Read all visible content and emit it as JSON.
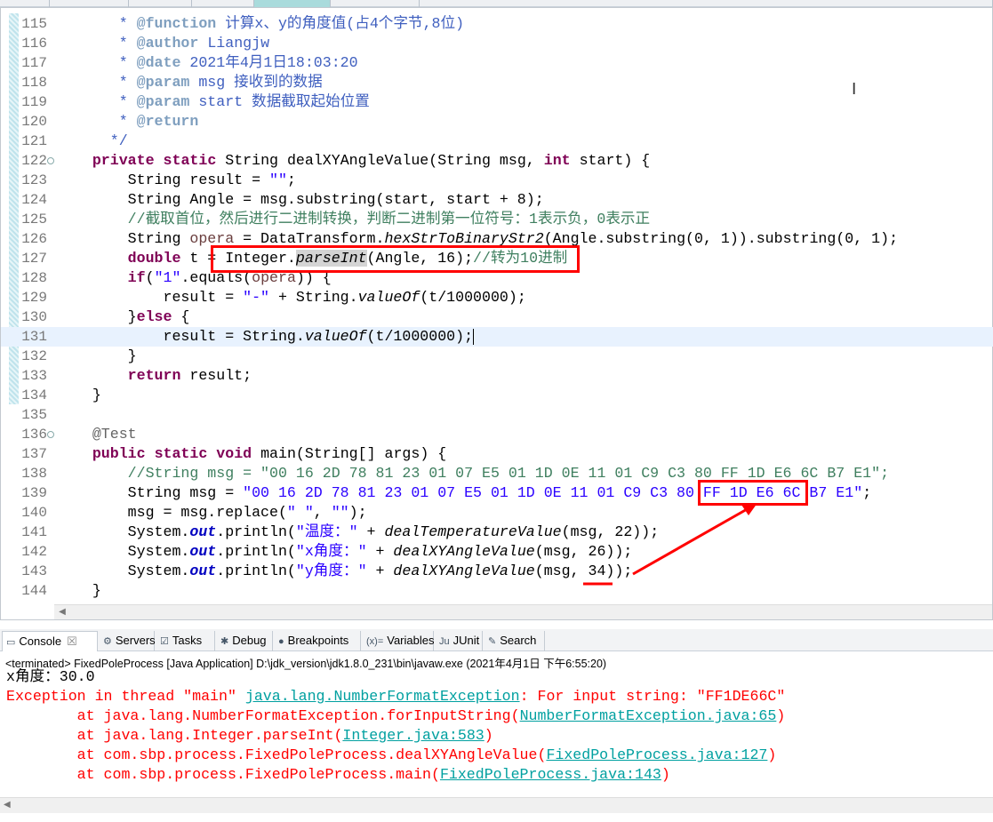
{
  "editor": {
    "lines": [
      {
        "n": "115",
        "t": [
          [
            "",
            "       "
          ],
          [
            "jd",
            "* "
          ],
          [
            "jt",
            "@function"
          ],
          [
            "jd",
            " 计算x、y的角度值(占4个字节,8位)"
          ]
        ]
      },
      {
        "n": "116",
        "t": [
          [
            "",
            "       "
          ],
          [
            "jd",
            "* "
          ],
          [
            "jt",
            "@author"
          ],
          [
            "jd",
            " Liangjw"
          ]
        ]
      },
      {
        "n": "117",
        "t": [
          [
            "",
            "       "
          ],
          [
            "jd",
            "* "
          ],
          [
            "jt",
            "@date"
          ],
          [
            "jd",
            " 2021年4月1日18:03:20"
          ]
        ]
      },
      {
        "n": "118",
        "t": [
          [
            "",
            "       "
          ],
          [
            "jd",
            "* "
          ],
          [
            "jt",
            "@param"
          ],
          [
            "jd",
            " msg 接收到的数据"
          ]
        ]
      },
      {
        "n": "119",
        "t": [
          [
            "",
            "       "
          ],
          [
            "jd",
            "* "
          ],
          [
            "jt",
            "@param"
          ],
          [
            "jd",
            " start 数据截取起始位置"
          ]
        ]
      },
      {
        "n": "120",
        "t": [
          [
            "",
            "       "
          ],
          [
            "jd",
            "* "
          ],
          [
            "jt",
            "@return"
          ]
        ]
      },
      {
        "n": "121",
        "t": [
          [
            "",
            "      "
          ],
          [
            "jd",
            "*/"
          ]
        ]
      },
      {
        "n": "122",
        "fold": true,
        "t": [
          [
            "",
            "    "
          ],
          [
            "kw",
            "private"
          ],
          [
            "",
            " "
          ],
          [
            "kw",
            "static"
          ],
          [
            "",
            " String dealXYAngleValue(String msg, "
          ],
          [
            "kw",
            "int"
          ],
          [
            "",
            " start) {"
          ]
        ]
      },
      {
        "n": "123",
        "t": [
          [
            "",
            "        String result = "
          ],
          [
            "st",
            "\"\""
          ],
          [
            "",
            ";"
          ]
        ]
      },
      {
        "n": "124",
        "t": [
          [
            "",
            "        String Angle = msg.substring(start, start + 8);"
          ]
        ]
      },
      {
        "n": "125",
        "t": [
          [
            "",
            "        "
          ],
          [
            "cm",
            "//截取首位，然后进行二进制转换，判断二进制第一位符号：1表示负，0表示正"
          ]
        ]
      },
      {
        "n": "126",
        "t": [
          [
            "",
            "        String "
          ],
          [
            "lv",
            "opera"
          ],
          [
            "",
            " = DataTransform."
          ],
          [
            "it",
            "hexStrToBinaryStr2"
          ],
          [
            "",
            "(Angle.substring(0, 1)).substring(0, 1);"
          ]
        ]
      },
      {
        "n": "127",
        "t": [
          [
            "",
            "        "
          ],
          [
            "kw",
            "double"
          ],
          [
            "",
            " t = Integer."
          ],
          [
            "it hl",
            "parseInt"
          ],
          [
            "",
            "(Angle, 16);"
          ],
          [
            "cm",
            "//转为10进制"
          ]
        ]
      },
      {
        "n": "128",
        "t": [
          [
            "",
            "        "
          ],
          [
            "kw",
            "if"
          ],
          [
            "",
            "("
          ],
          [
            "st",
            "\"1\""
          ],
          [
            "",
            ".equals("
          ],
          [
            "lv",
            "opera"
          ],
          [
            "",
            ")) {"
          ]
        ]
      },
      {
        "n": "129",
        "t": [
          [
            "",
            "            result = "
          ],
          [
            "st",
            "\"-\""
          ],
          [
            "",
            " + String."
          ],
          [
            "it",
            "valueOf"
          ],
          [
            "",
            "(t/1000000);"
          ]
        ]
      },
      {
        "n": "130",
        "t": [
          [
            "",
            "        }"
          ],
          [
            "kw",
            "else"
          ],
          [
            "",
            " {"
          ]
        ]
      },
      {
        "n": "131",
        "cur": true,
        "t": [
          [
            "",
            "            result = String."
          ],
          [
            "it",
            "valueOf"
          ],
          [
            "",
            "(t/1000000);"
          ]
        ]
      },
      {
        "n": "132",
        "t": [
          [
            "",
            "        }"
          ]
        ]
      },
      {
        "n": "133",
        "t": [
          [
            "",
            "        "
          ],
          [
            "kw",
            "return"
          ],
          [
            "",
            " result;"
          ]
        ]
      },
      {
        "n": "134",
        "t": [
          [
            "",
            "    }"
          ]
        ]
      },
      {
        "n": "135",
        "t": []
      },
      {
        "n": "136",
        "fold": true,
        "t": [
          [
            "",
            "    "
          ],
          [
            "an",
            "@Test"
          ]
        ]
      },
      {
        "n": "137",
        "t": [
          [
            "",
            "    "
          ],
          [
            "kw",
            "public"
          ],
          [
            "",
            " "
          ],
          [
            "kw",
            "static"
          ],
          [
            "",
            " "
          ],
          [
            "kw",
            "void"
          ],
          [
            "",
            " main(String[] args) {"
          ]
        ]
      },
      {
        "n": "138",
        "t": [
          [
            "",
            "        "
          ],
          [
            "cm",
            "//String msg = \"00 16 2D 78 81 23 01 07 E5 01 1D 0E 11 01 C9 C3 80 FF 1D E6 6C B7 E1\";"
          ]
        ]
      },
      {
        "n": "139",
        "t": [
          [
            "",
            "        String msg = "
          ],
          [
            "st",
            "\"00 16 2D 78 81 23 01 07 E5 01 1D 0E 11 01 C9 C3 80 FF 1D E6 6C B7 E1\""
          ],
          [
            "",
            ";"
          ]
        ]
      },
      {
        "n": "140",
        "t": [
          [
            "",
            "        msg = msg.replace("
          ],
          [
            "st",
            "\" \""
          ],
          [
            "",
            ", "
          ],
          [
            "st",
            "\"\""
          ],
          [
            "",
            ");"
          ]
        ]
      },
      {
        "n": "141",
        "t": [
          [
            "",
            "        System."
          ],
          [
            "fld",
            "out"
          ],
          [
            "",
            ".println("
          ],
          [
            "st",
            "\"温度：\""
          ],
          [
            "",
            " + "
          ],
          [
            "it",
            "dealTemperatureValue"
          ],
          [
            "",
            "(msg, 22));"
          ]
        ]
      },
      {
        "n": "142",
        "t": [
          [
            "",
            "        System."
          ],
          [
            "fld",
            "out"
          ],
          [
            "",
            ".println("
          ],
          [
            "st",
            "\"x角度：\""
          ],
          [
            "",
            " + "
          ],
          [
            "it",
            "dealXYAngleValue"
          ],
          [
            "",
            "(msg, 26));"
          ]
        ]
      },
      {
        "n": "143",
        "t": [
          [
            "",
            "        System."
          ],
          [
            "fld",
            "out"
          ],
          [
            "",
            ".println("
          ],
          [
            "st",
            "\"y角度：\""
          ],
          [
            "",
            " + "
          ],
          [
            "it",
            "dealXYAngleValue"
          ],
          [
            "",
            "(msg, 34));"
          ]
        ]
      },
      {
        "n": "144",
        "t": [
          [
            "",
            "    }"
          ]
        ]
      }
    ]
  },
  "console": {
    "tabs": [
      {
        "label": "Console",
        "icon": "console-icon",
        "glyph": "▭",
        "active": true
      },
      {
        "label": "Servers",
        "icon": "servers-icon",
        "glyph": "⚙"
      },
      {
        "label": "Tasks",
        "icon": "tasks-icon",
        "glyph": "☑"
      },
      {
        "label": "Debug",
        "icon": "debug-icon",
        "glyph": "✱"
      },
      {
        "label": "Breakpoints",
        "icon": "breakpoints-icon",
        "glyph": "●"
      },
      {
        "label": "Variables",
        "icon": "variables-icon",
        "glyph": "(x)="
      },
      {
        "label": "JUnit",
        "icon": "junit-icon",
        "glyph": "Ju"
      },
      {
        "label": "Search",
        "icon": "search-icon",
        "glyph": "✎"
      }
    ],
    "close_glyph": "☒",
    "info": "<terminated> FixedPoleProcess [Java Application] D:\\jdk_version\\jdk1.8.0_231\\bin\\javaw.exe (2021年4月1日 下午6:55:20)",
    "lines": [
      [
        [
          "",
          "x角度：30.0"
        ]
      ],
      [
        [
          "err",
          "Exception in thread \"main\" "
        ],
        [
          "lnk",
          "java.lang.NumberFormatException"
        ],
        [
          "err",
          ": For input string: \"FF1DE66C\""
        ]
      ],
      [
        [
          "err",
          "        at java.lang.NumberFormatException.forInputString("
        ],
        [
          "lnk",
          "NumberFormatException.java:65"
        ],
        [
          "err",
          ")"
        ]
      ],
      [
        [
          "err",
          "        at java.lang.Integer.parseInt("
        ],
        [
          "lnk",
          "Integer.java:583"
        ],
        [
          "err",
          ")"
        ]
      ],
      [
        [
          "err",
          "        at com.sbp.process.FixedPoleProcess.dealXYAngleValue("
        ],
        [
          "lnk",
          "FixedPoleProcess.java:127"
        ],
        [
          "err",
          ")"
        ]
      ],
      [
        [
          "err",
          "        at com.sbp.process.FixedPoleProcess.main("
        ],
        [
          "lnk",
          "FixedPoleProcess.java:143"
        ],
        [
          "err",
          ")"
        ]
      ]
    ]
  },
  "annotation_color": "#ff0000"
}
